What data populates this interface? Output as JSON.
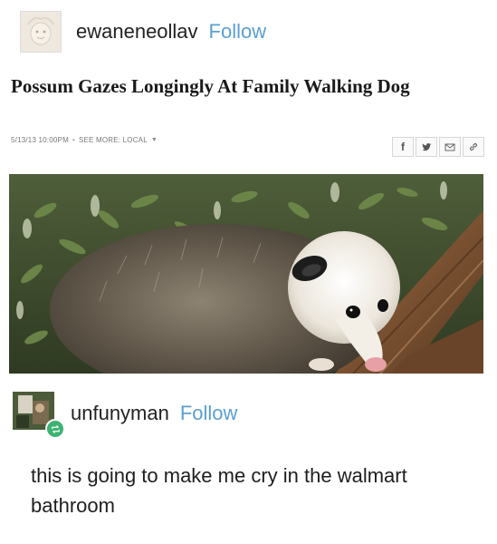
{
  "original_post": {
    "username": "ewaneneollav",
    "follow_label": "Follow",
    "avatar_icon": "default-avatar-icon"
  },
  "article": {
    "headline": "Possum Gazes Longingly At Family Walking Dog",
    "date": "5/13/13 10:00PM",
    "separator": "•",
    "see_more": "SEE MORE: LOCAL",
    "share_icons": [
      "facebook-icon",
      "twitter-icon",
      "email-icon",
      "link-icon"
    ],
    "facebook_glyph": "f",
    "twitter_glyph": "🐦",
    "photo_icon": "possum-photo"
  },
  "reblog": {
    "username": "unfunyman",
    "follow_label": "Follow",
    "reblog_icon": "reblog-icon",
    "comment": "this is going to make me cry in the walmart bathroom"
  },
  "colors": {
    "follow": "#5a9fd4",
    "reblog_badge": "#3cb371"
  }
}
